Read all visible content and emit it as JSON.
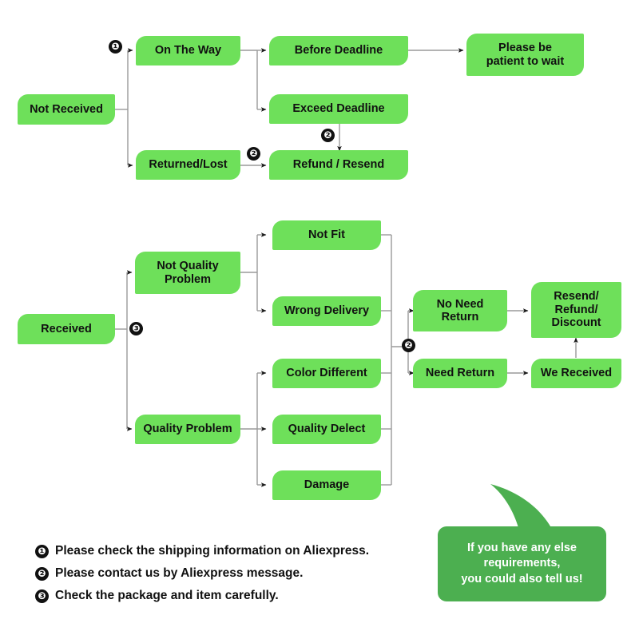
{
  "colors": {
    "node_green": "#6ee05a",
    "callout_green": "#4caf50",
    "wire_gray": "#9a9a9a",
    "badge_black": "#111111",
    "text_dark": "#111111",
    "callout_text": "#ffffff",
    "background": "#ffffff"
  },
  "flow": {
    "not_received_branch": {
      "root": "Not Received",
      "on_the_way": "On The Way",
      "before_deadline": "Before Deadline",
      "please_be_patient": "Please be\npatient to wait",
      "exceed_deadline": "Exceed Deadline",
      "returned_lost": "Returned/Lost",
      "refund_resend": "Refund / Resend"
    },
    "received_branch": {
      "root": "Received",
      "not_quality_problem": "Not Quality\nProblem",
      "quality_problem": "Quality Problem",
      "not_fit": "Not Fit",
      "wrong_delivery": "Wrong Delivery",
      "color_different": "Color Different",
      "quality_delect": "Quality Delect",
      "damage": "Damage",
      "no_need_return": "No Need\nReturn",
      "need_return": "Need Return",
      "we_received": "We Received",
      "resend_refund_discount": "Resend/\nRefund/\nDiscount"
    }
  },
  "badges": {
    "b1": "❶",
    "b2": "❷",
    "b3": "❸"
  },
  "legend": {
    "items": [
      {
        "marker": "❶",
        "text": "Please check the shipping information on Aliexpress."
      },
      {
        "marker": "❷",
        "text": "Please contact us by Aliexpress message."
      },
      {
        "marker": "❸",
        "text": "Check the package and item carefully."
      }
    ]
  },
  "callout": {
    "text": "If you have any else\nrequirements,\nyou could also tell us!"
  }
}
